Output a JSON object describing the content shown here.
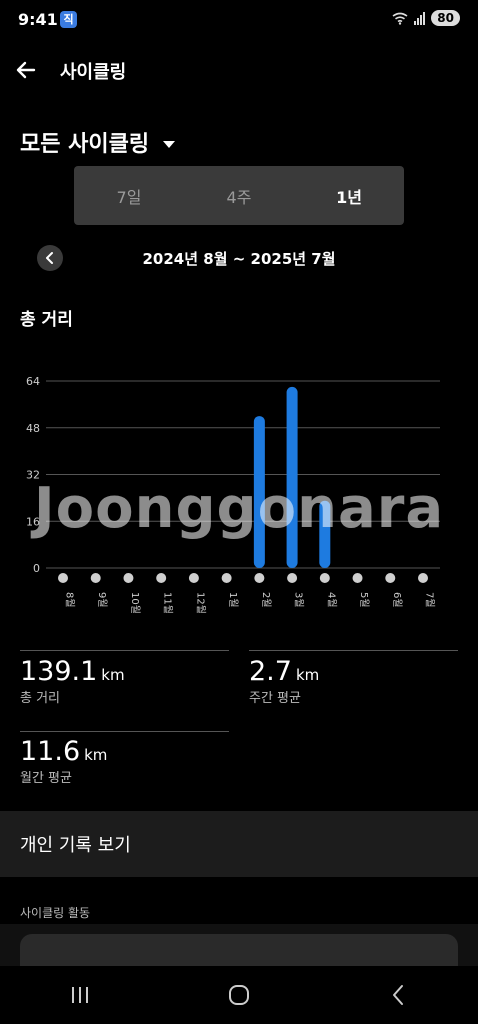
{
  "status_bar": {
    "time": "9:41",
    "app_badge": "직",
    "battery": "80"
  },
  "header": {
    "title": "사이클링"
  },
  "filter": {
    "label": "모든 사이클링"
  },
  "segment": {
    "tabs": [
      "7일",
      "4주",
      "1년"
    ],
    "selected": "1년"
  },
  "date_range": "2024년 8월 ~ 2025년 7월",
  "section_title": "총 거리",
  "chart_data": {
    "type": "bar",
    "categories": [
      "8월",
      "9월",
      "10월",
      "11월",
      "12월",
      "1월",
      "2월",
      "3월",
      "4월",
      "5월",
      "6월",
      "7월"
    ],
    "values": [
      0,
      0,
      0,
      0,
      0,
      0,
      52,
      62,
      23,
      0,
      0,
      0
    ],
    "ylim": [
      0,
      64
    ],
    "yticks": [
      "0",
      "16",
      "32",
      "48",
      "64"
    ],
    "bar_color": "#1e7be0",
    "zero_dot_color": "#cfcfcf"
  },
  "stats": {
    "total": {
      "value": "139.1",
      "unit": "km",
      "label": "총 거리"
    },
    "weekly": {
      "value": "2.7",
      "unit": "km",
      "label": "주간 평균"
    },
    "monthly": {
      "value": "11.6",
      "unit": "km",
      "label": "월간 평균"
    }
  },
  "records": {
    "label": "개인 기록 보기"
  },
  "activity": {
    "label": "사이클링 활동"
  },
  "watermark": "Joonggonara"
}
